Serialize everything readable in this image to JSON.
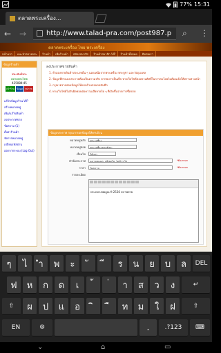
{
  "status_bar": {
    "battery": "77%",
    "time": "15:31"
  },
  "browser": {
    "tab_title": "ตลาดพระเครื่อง...",
    "url": "http://www.talad-pra.com/post987.p",
    "back_icon": "back-arrow-icon",
    "forward_icon": "forward-arrow-icon",
    "search_icon": "search-icon",
    "menu_icon": "overflow-menu-icon"
  },
  "page": {
    "banner_text": "ตลาดพระเครื่อง ไทย พระเครื่อง",
    "nav": [
      "หน้าแรก",
      "แนะนำตลาดพระ",
      "ร้านค้า",
      "เพิ่มร้านค้า",
      "สมัครสมาชิก",
      "ร้านค้าสมาชิก VIP",
      "ร้านค้าทั้งหมด",
      "ติดต่อเรา"
    ],
    "sidebar": {
      "header": "ข้อมูลร้านค้า",
      "shop_line1": "ชนะพันธ์พระ",
      "shop_line2": "ตลาดพระไทย",
      "counter": "425084:45",
      "btn1": "เข้าร้าน",
      "btn2": "ข้อมูล",
      "btn3": "รูปภาพ",
      "menu": [
        "แก้ไขข้อมูลร้าน VIP",
        "สร้างหมวดหมู่",
        "เพิ่ม/แก้ไขสินค้า",
        "ลงประกาศขาย",
        "ข้อความ (1)",
        "ตั้งค่าร้านค้า",
        "จัดการหมวดหมู่",
        "เปลี่ยนรหัสผ่าน",
        "ออกจากระบบ (Log Out)"
      ]
    },
    "content_title": "ลงประกาศขายสินค้า",
    "rules": [
      "1. ห้ามลงขายสินค้าประเภทอื่น ๆ นอกเหนือจากพระเครื่อง พระบูชา และวัตถุมงคล",
      "2. ข้อมูลที่ท่านลงประกาศต้องเป็นความจริง หากพบว่าเป็นเท็จ ทางเว็บไซต์ขอสงวนสิทธิ์ในการลบโดยไม่ต้องแจ้งให้ทราบล่วงหน้า",
      "3. กรุณาตรวจสอบข้อมูลให้ครบถ้วนก่อนกดบันทึก",
      "4. ทางเว็บไซต์ไม่รับผิดชอบต่อความเสียหายใด ๆ ที่เกิดขึ้นจากการซื้อขาย"
    ],
    "form": {
      "header": "ข้อมูลประกาศ กรุณากรอกข้อมูลให้ครบถ้วน",
      "fields": [
        {
          "label": "หมวดหมู่หลัก",
          "value": "พระเครื่อง"
        },
        {
          "label": "หมวดหมู่ย่อย",
          "value": "พระเครื่องยอดนิยม"
        },
        {
          "label": "เงื่อนไข",
          "value": "ให้เช่า"
        },
        {
          "label": "หัวข้อประกาศ",
          "value": "หลวงพ่อคูณ ปริสุทโธ วัดบ้านไร่",
          "hint": "*ต้องกรอก"
        },
        {
          "label": "ราคา",
          "value": "โทรถาม",
          "hint": "*ต้องกรอก"
        }
      ],
      "detail_label": "รายละเอียด",
      "editor_text": "พระหลวงพ่อคูณ ปี 2536 สภาพสวย"
    }
  },
  "keyboard": {
    "row1": [
      "ๆ",
      "ไ",
      "ำ",
      "พ",
      "ะ",
      "ั",
      "ี",
      "ร",
      "น",
      "ย",
      "บ",
      "ล",
      "DEL"
    ],
    "row2": [
      "ฟ",
      "ห",
      "ก",
      "ด",
      "เ",
      "้",
      "่",
      "า",
      "ส",
      "ว",
      "ง",
      "↵"
    ],
    "row3": [
      "⇧",
      "ผ",
      "ป",
      "แ",
      "อ",
      "ิ",
      "ื",
      "ท",
      "ม",
      "ใ",
      "ฝ",
      "⇧"
    ],
    "row4": [
      "EN",
      "⚙",
      "",
      ".",
      ".?123",
      "⌨"
    ]
  }
}
